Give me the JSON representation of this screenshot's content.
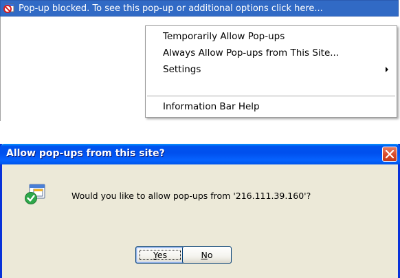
{
  "info_bar": {
    "icon": "popup-blocked-icon",
    "text": "Pop-up blocked. To see this pop-up or additional options click here..."
  },
  "context_menu": {
    "items": [
      {
        "label": "Temporarily Allow Pop-ups"
      },
      {
        "label": "Always Allow Pop-ups from This Site..."
      },
      {
        "label": "Settings",
        "submenu": true
      },
      {
        "label": "Information Bar Help"
      }
    ]
  },
  "dialog": {
    "title": "Allow pop-ups from this site?",
    "icon": "popup-allow-check-icon",
    "message": "Would you like to allow pop-ups from '216.111.39.160'?",
    "buttons": {
      "yes": "Yes",
      "no": "No"
    }
  },
  "colors": {
    "info_bar_bg": "#316ac5",
    "title_bar": "#0054e3",
    "dialog_bg": "#ece9d8",
    "close_button": "#d84a2a"
  }
}
